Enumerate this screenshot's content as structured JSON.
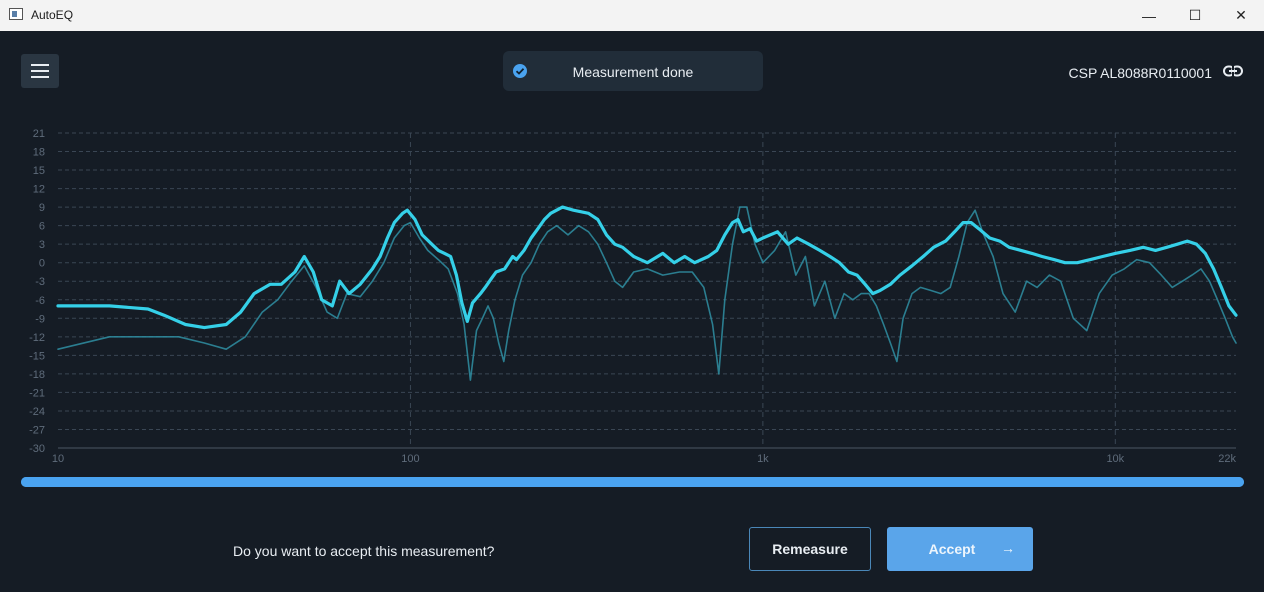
{
  "window": {
    "title": "AutoEQ",
    "controls": {
      "minimize": "—",
      "maximize": "☐",
      "close": "✕"
    }
  },
  "header": {
    "menu_icon": "hamburger-menu-icon",
    "status": {
      "icon": "check-circle-icon",
      "text": "Measurement done"
    },
    "device": {
      "name": "CSP AL8088R0110001",
      "icon": "link-icon"
    }
  },
  "chart_data": {
    "type": "line",
    "x_scale": "log",
    "xlim": [
      10,
      22000
    ],
    "ylim": [
      -30,
      21
    ],
    "x_ticks": [
      {
        "value": 10,
        "label": "10"
      },
      {
        "value": 100,
        "label": "100"
      },
      {
        "value": 1000,
        "label": "1k"
      },
      {
        "value": 10000,
        "label": "10k"
      },
      {
        "value": 22000,
        "label": "22k"
      }
    ],
    "y_ticks": [
      21,
      18,
      15,
      12,
      9,
      6,
      3,
      0,
      -3,
      -6,
      -9,
      -12,
      -15,
      -18,
      -21,
      -24,
      -27,
      -30
    ],
    "grid": true,
    "series": [
      {
        "role": "average",
        "color": "#35d0e8",
        "points": [
          [
            10,
            -7
          ],
          [
            14,
            -7
          ],
          [
            18,
            -7.5
          ],
          [
            20,
            -8.5
          ],
          [
            23,
            -10
          ],
          [
            26,
            -10.5
          ],
          [
            30,
            -10
          ],
          [
            33,
            -8
          ],
          [
            36,
            -5
          ],
          [
            40,
            -3.5
          ],
          [
            43,
            -3.5
          ],
          [
            47,
            -1.5
          ],
          [
            50,
            1
          ],
          [
            53,
            -1.5
          ],
          [
            56,
            -6
          ],
          [
            60,
            -7
          ],
          [
            63,
            -3
          ],
          [
            67,
            -5
          ],
          [
            72,
            -3.5
          ],
          [
            78,
            -1
          ],
          [
            82,
            1
          ],
          [
            86,
            4
          ],
          [
            90,
            6.5
          ],
          [
            95,
            8
          ],
          [
            98,
            8.5
          ],
          [
            103,
            7
          ],
          [
            108,
            4.5
          ],
          [
            115,
            3
          ],
          [
            120,
            2
          ],
          [
            125,
            1.5
          ],
          [
            130,
            1
          ],
          [
            135,
            -2
          ],
          [
            140,
            -6.5
          ],
          [
            145,
            -9.5
          ],
          [
            150,
            -6.5
          ],
          [
            158,
            -5
          ],
          [
            163,
            -4
          ],
          [
            170,
            -2.5
          ],
          [
            175,
            -1.5
          ],
          [
            185,
            -1
          ],
          [
            195,
            1
          ],
          [
            200,
            0.5
          ],
          [
            210,
            2
          ],
          [
            220,
            4
          ],
          [
            230,
            5.5
          ],
          [
            240,
            7
          ],
          [
            250,
            8
          ],
          [
            270,
            9
          ],
          [
            290,
            8.5
          ],
          [
            320,
            8
          ],
          [
            340,
            7
          ],
          [
            360,
            4.5
          ],
          [
            380,
            3
          ],
          [
            400,
            2.5
          ],
          [
            430,
            1
          ],
          [
            470,
            0
          ],
          [
            520,
            1.5
          ],
          [
            560,
            0
          ],
          [
            600,
            1
          ],
          [
            640,
            0
          ],
          [
            700,
            1
          ],
          [
            740,
            2
          ],
          [
            780,
            4.5
          ],
          [
            820,
            6.5
          ],
          [
            850,
            7
          ],
          [
            880,
            5
          ],
          [
            920,
            5.5
          ],
          [
            960,
            3.5
          ],
          [
            1000,
            4
          ],
          [
            1100,
            5
          ],
          [
            1180,
            3
          ],
          [
            1250,
            4
          ],
          [
            1350,
            3
          ],
          [
            1450,
            2
          ],
          [
            1550,
            1
          ],
          [
            1650,
            0
          ],
          [
            1750,
            -1.5
          ],
          [
            1850,
            -2
          ],
          [
            1950,
            -3.5
          ],
          [
            2050,
            -5
          ],
          [
            2150,
            -4.5
          ],
          [
            2300,
            -3.5
          ],
          [
            2450,
            -2
          ],
          [
            2650,
            -0.5
          ],
          [
            2850,
            1
          ],
          [
            3050,
            2.5
          ],
          [
            3300,
            3.5
          ],
          [
            3500,
            5
          ],
          [
            3700,
            6.5
          ],
          [
            3900,
            6.5
          ],
          [
            4100,
            5.5
          ],
          [
            4400,
            4
          ],
          [
            4700,
            3.5
          ],
          [
            5000,
            2.5
          ],
          [
            5400,
            2
          ],
          [
            5800,
            1.5
          ],
          [
            6200,
            1
          ],
          [
            6700,
            0.5
          ],
          [
            7200,
            0
          ],
          [
            7800,
            0
          ],
          [
            8500,
            0.5
          ],
          [
            9200,
            1
          ],
          [
            10000,
            1.5
          ],
          [
            11000,
            2
          ],
          [
            12000,
            2.5
          ],
          [
            13000,
            2
          ],
          [
            14000,
            2.5
          ],
          [
            15000,
            3
          ],
          [
            16000,
            3.5
          ],
          [
            17000,
            3
          ],
          [
            18000,
            1.5
          ],
          [
            19000,
            -1
          ],
          [
            20000,
            -4
          ],
          [
            21000,
            -7
          ],
          [
            22000,
            -8.5
          ]
        ]
      },
      {
        "role": "individual",
        "color": "#2f8fa3",
        "points": [
          [
            10,
            -14
          ],
          [
            14,
            -12
          ],
          [
            18,
            -12
          ],
          [
            22,
            -12
          ],
          [
            26,
            -13
          ],
          [
            30,
            -14
          ],
          [
            34,
            -12
          ],
          [
            38,
            -8
          ],
          [
            42,
            -6
          ],
          [
            46,
            -3
          ],
          [
            50,
            -0.5
          ],
          [
            54,
            -4
          ],
          [
            58,
            -8
          ],
          [
            62,
            -9
          ],
          [
            66,
            -5
          ],
          [
            72,
            -5.5
          ],
          [
            78,
            -3
          ],
          [
            84,
            0
          ],
          [
            90,
            4
          ],
          [
            96,
            6
          ],
          [
            100,
            6.5
          ],
          [
            106,
            4
          ],
          [
            112,
            2
          ],
          [
            120,
            0.5
          ],
          [
            128,
            -1
          ],
          [
            136,
            -5
          ],
          [
            142,
            -10
          ],
          [
            148,
            -19
          ],
          [
            154,
            -11
          ],
          [
            160,
            -9
          ],
          [
            166,
            -7
          ],
          [
            172,
            -9
          ],
          [
            178,
            -13
          ],
          [
            184,
            -16
          ],
          [
            190,
            -11
          ],
          [
            198,
            -6
          ],
          [
            208,
            -2
          ],
          [
            220,
            0
          ],
          [
            232,
            3
          ],
          [
            245,
            5
          ],
          [
            260,
            6
          ],
          [
            280,
            4.5
          ],
          [
            300,
            6
          ],
          [
            320,
            5
          ],
          [
            340,
            3
          ],
          [
            360,
            0
          ],
          [
            380,
            -3
          ],
          [
            400,
            -4
          ],
          [
            430,
            -1.5
          ],
          [
            470,
            -1
          ],
          [
            520,
            -2
          ],
          [
            580,
            -1.5
          ],
          [
            630,
            -1.5
          ],
          [
            680,
            -4
          ],
          [
            720,
            -10
          ],
          [
            750,
            -18
          ],
          [
            780,
            -6
          ],
          [
            820,
            3
          ],
          [
            860,
            9
          ],
          [
            900,
            9
          ],
          [
            950,
            3
          ],
          [
            1000,
            0
          ],
          [
            1080,
            2
          ],
          [
            1160,
            5
          ],
          [
            1240,
            -2
          ],
          [
            1320,
            1
          ],
          [
            1400,
            -7
          ],
          [
            1500,
            -3
          ],
          [
            1600,
            -9
          ],
          [
            1700,
            -5
          ],
          [
            1800,
            -6
          ],
          [
            1900,
            -5
          ],
          [
            2000,
            -5
          ],
          [
            2100,
            -7
          ],
          [
            2200,
            -10
          ],
          [
            2300,
            -13
          ],
          [
            2400,
            -16
          ],
          [
            2500,
            -9
          ],
          [
            2650,
            -5
          ],
          [
            2800,
            -4
          ],
          [
            3000,
            -4.5
          ],
          [
            3200,
            -5
          ],
          [
            3400,
            -4
          ],
          [
            3600,
            1
          ],
          [
            3800,
            6.5
          ],
          [
            4000,
            8.5
          ],
          [
            4200,
            5
          ],
          [
            4500,
            1
          ],
          [
            4800,
            -5
          ],
          [
            5200,
            -8
          ],
          [
            5600,
            -3
          ],
          [
            6000,
            -4
          ],
          [
            6500,
            -2
          ],
          [
            7000,
            -3
          ],
          [
            7600,
            -9
          ],
          [
            8300,
            -11
          ],
          [
            9000,
            -5
          ],
          [
            9800,
            -2
          ],
          [
            10600,
            -1
          ],
          [
            11500,
            0.5
          ],
          [
            12500,
            0
          ],
          [
            13500,
            -2
          ],
          [
            14500,
            -4
          ],
          [
            15500,
            -3
          ],
          [
            16500,
            -2
          ],
          [
            17500,
            -1
          ],
          [
            18500,
            -3
          ],
          [
            19500,
            -6
          ],
          [
            20500,
            -9
          ],
          [
            21500,
            -12
          ],
          [
            22000,
            -13
          ]
        ]
      }
    ]
  },
  "progress": {
    "value": 1.0
  },
  "footer": {
    "question": "Do you want to accept this measurement?",
    "remeasure_label": "Remeasure",
    "accept_label": "Accept",
    "accept_icon": "arrow-right-icon"
  },
  "colors": {
    "background": "#151c25",
    "accent": "#4aa3f0",
    "curve": "#35d0e8",
    "accept_button": "#5aa5ea"
  }
}
